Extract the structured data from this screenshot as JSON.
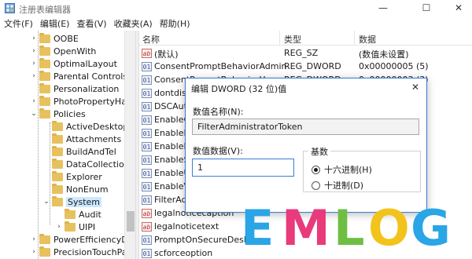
{
  "window": {
    "title": "注册表编辑器",
    "icon": "regedit-icon",
    "controls": {
      "minimize": "—",
      "maximize": "☐",
      "close": "✕"
    }
  },
  "menu": [
    "文件(F)",
    "编辑(E)",
    "查看(V)",
    "收藏夹(A)",
    "帮助(H)"
  ],
  "tree": {
    "items": [
      {
        "label": "OOBE",
        "expander": "›"
      },
      {
        "label": "OpenWith",
        "expander": "›"
      },
      {
        "label": "OptimalLayout",
        "expander": "›"
      },
      {
        "label": "Parental Controls",
        "expander": "›"
      },
      {
        "label": "Personalization",
        "expander": ""
      },
      {
        "label": "PhotoPropertyHandler",
        "expander": "›"
      },
      {
        "label": "Policies",
        "expander": "⌄"
      },
      {
        "label": "ActiveDesktop",
        "expander": ""
      },
      {
        "label": "Attachments",
        "expander": ""
      },
      {
        "label": "BuildAndTel",
        "expander": ""
      },
      {
        "label": "DataCollection",
        "expander": ""
      },
      {
        "label": "Explorer",
        "expander": ""
      },
      {
        "label": "NonEnum",
        "expander": ""
      },
      {
        "label": "System",
        "expander": "⌄",
        "selected": true
      },
      {
        "label": "Audit",
        "expander": ""
      },
      {
        "label": "UIPI",
        "expander": "›"
      },
      {
        "label": "PowerEfficiencyDiag",
        "expander": "›"
      },
      {
        "label": "PrecisionTouchPad",
        "expander": "›"
      }
    ]
  },
  "list": {
    "columns": {
      "name": "名称",
      "type": "类型",
      "data": "数据"
    },
    "rows": [
      {
        "icon": "ab",
        "name": "(默认)",
        "type": "REG_SZ",
        "data": "(数值未设置)"
      },
      {
        "icon": "bin",
        "name": "ConsentPromptBehaviorAdmin",
        "type": "REG_DWORD",
        "data": "0x00000005 (5)"
      },
      {
        "icon": "bin",
        "name": "ConsentPromptBehaviorUser",
        "type": "REG_DWORD",
        "data": "0x00000003 (3)"
      },
      {
        "icon": "bin",
        "name": "dontdisplaylastusername",
        "type": "",
        "data": ""
      },
      {
        "icon": "bin",
        "name": "DSCAutomationHostEnabled",
        "type": "",
        "data": ""
      },
      {
        "icon": "bin",
        "name": "EnableCursorSuppression",
        "type": "",
        "data": ""
      },
      {
        "icon": "bin",
        "name": "EnableInstallerDetection",
        "type": "",
        "data": ""
      },
      {
        "icon": "bin",
        "name": "EnableLUA",
        "type": "",
        "data": ""
      },
      {
        "icon": "bin",
        "name": "EnableSecureUIAPaths",
        "type": "",
        "data": ""
      },
      {
        "icon": "bin",
        "name": "EnableUIADesktopToggle",
        "type": "",
        "data": ""
      },
      {
        "icon": "bin",
        "name": "EnableVirtualization",
        "type": "",
        "data": ""
      },
      {
        "icon": "bin",
        "name": "FilterAdministratorToken",
        "type": "",
        "data": ""
      },
      {
        "icon": "ab",
        "name": "legalnoticecaption",
        "type": "",
        "data": ""
      },
      {
        "icon": "ab",
        "name": "legalnoticetext",
        "type": "",
        "data": ""
      },
      {
        "icon": "bin",
        "name": "PromptOnSecureDesktop",
        "type": "",
        "data": ""
      },
      {
        "icon": "bin",
        "name": "scforceoption",
        "type": "",
        "data": ""
      }
    ]
  },
  "dialog": {
    "title": "编辑 DWORD (32 位)值",
    "close": "✕",
    "name_label": "数值名称(N):",
    "name_value": "FilterAdministratorToken",
    "data_label": "数值数据(V):",
    "data_value": "1",
    "base_label": "基数",
    "radio_hex": "十六进制(H)",
    "radio_dec": "十进制(D)",
    "base_selected": "hex"
  },
  "watermark": {
    "text": "EMLOG",
    "letters": [
      {
        "char": "E",
        "color": "#2aa5e6"
      },
      {
        "char": "M",
        "color": "#e93a7c"
      },
      {
        "char": "L",
        "color": "#6ebe44"
      },
      {
        "char": "O",
        "color": "#f2c31b"
      },
      {
        "char": "G",
        "color": "#2aa5e6"
      }
    ]
  }
}
